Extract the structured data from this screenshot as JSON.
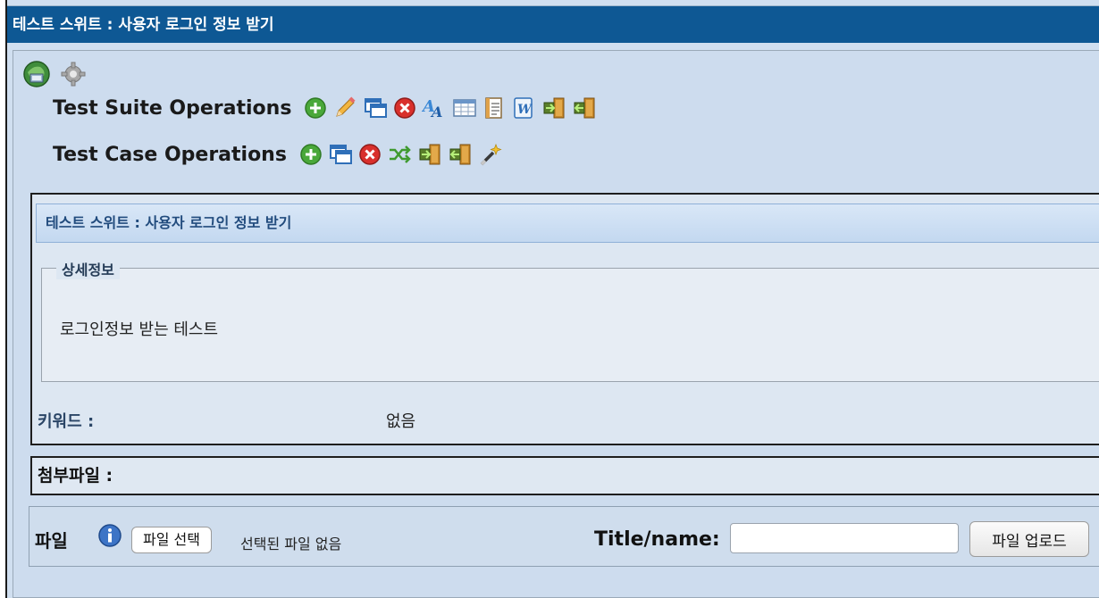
{
  "window": {
    "title": "테스트 스위트 : 사용자 로그인 정보 받기"
  },
  "toolbar": {
    "icons": [
      "globe-refresh-icon",
      "gear-icon"
    ],
    "suite_ops_label": "Test Suite Operations",
    "suite_ops_icons": [
      "add-icon",
      "pencil-icon",
      "copy-icon",
      "delete-icon",
      "translate-icon",
      "table-icon",
      "document-icon",
      "word-icon",
      "import-icon",
      "export-icon"
    ],
    "case_ops_label": "Test Case Operations",
    "case_ops_icons": [
      "add-icon",
      "copy-icon",
      "delete-icon",
      "shuffle-icon",
      "import-icon",
      "export-icon",
      "magic-wand-icon"
    ]
  },
  "details": {
    "header": "테스트 스위트 : 사용자 로그인 정보 받기",
    "legend": "상세정보",
    "description": "로그인정보 받는 테스트",
    "keywords_label": "키워드 :",
    "keywords_value": "없음"
  },
  "attachments": {
    "label": "첨부파일 :"
  },
  "upload": {
    "file_label": "파일",
    "choose_button": "파일 선택",
    "no_file_text": "선택된 파일 없음",
    "title_label": "Title/name:",
    "title_value": "",
    "upload_button": "파일 업로드"
  },
  "colors": {
    "titlebar": "#0e5894",
    "background": "#cddcee",
    "add_green": "#4aa83a",
    "delete_red": "#d9302c"
  }
}
